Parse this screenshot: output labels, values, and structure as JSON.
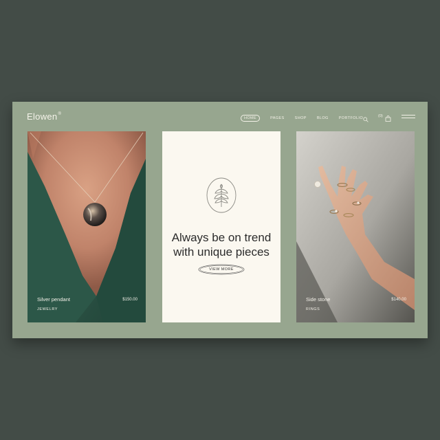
{
  "brand": {
    "name": "Elowen",
    "mark": "®"
  },
  "nav": {
    "items": [
      "HOME",
      "PAGES",
      "SHOP",
      "BLOG",
      "PORTFOLIO"
    ],
    "cart_count": "(0)",
    "icons": [
      "search-icon",
      "shopping-bag-icon",
      "menu-icon"
    ]
  },
  "cards": {
    "left": {
      "title": "Silver pendant",
      "category": "JEWELRY",
      "price": "$150.00"
    },
    "middle": {
      "heading_line1": "Always be on trend",
      "heading_line2": "with unique pieces",
      "button": "VIEW MORE"
    },
    "right": {
      "title": "Side stone",
      "category": "RINGS",
      "price": "$140.00"
    }
  },
  "colors": {
    "page_bg": "#434c47",
    "site_bg": "#97a68f",
    "card_cream": "#fbf8f0",
    "jacket_green": "#2f5547"
  }
}
